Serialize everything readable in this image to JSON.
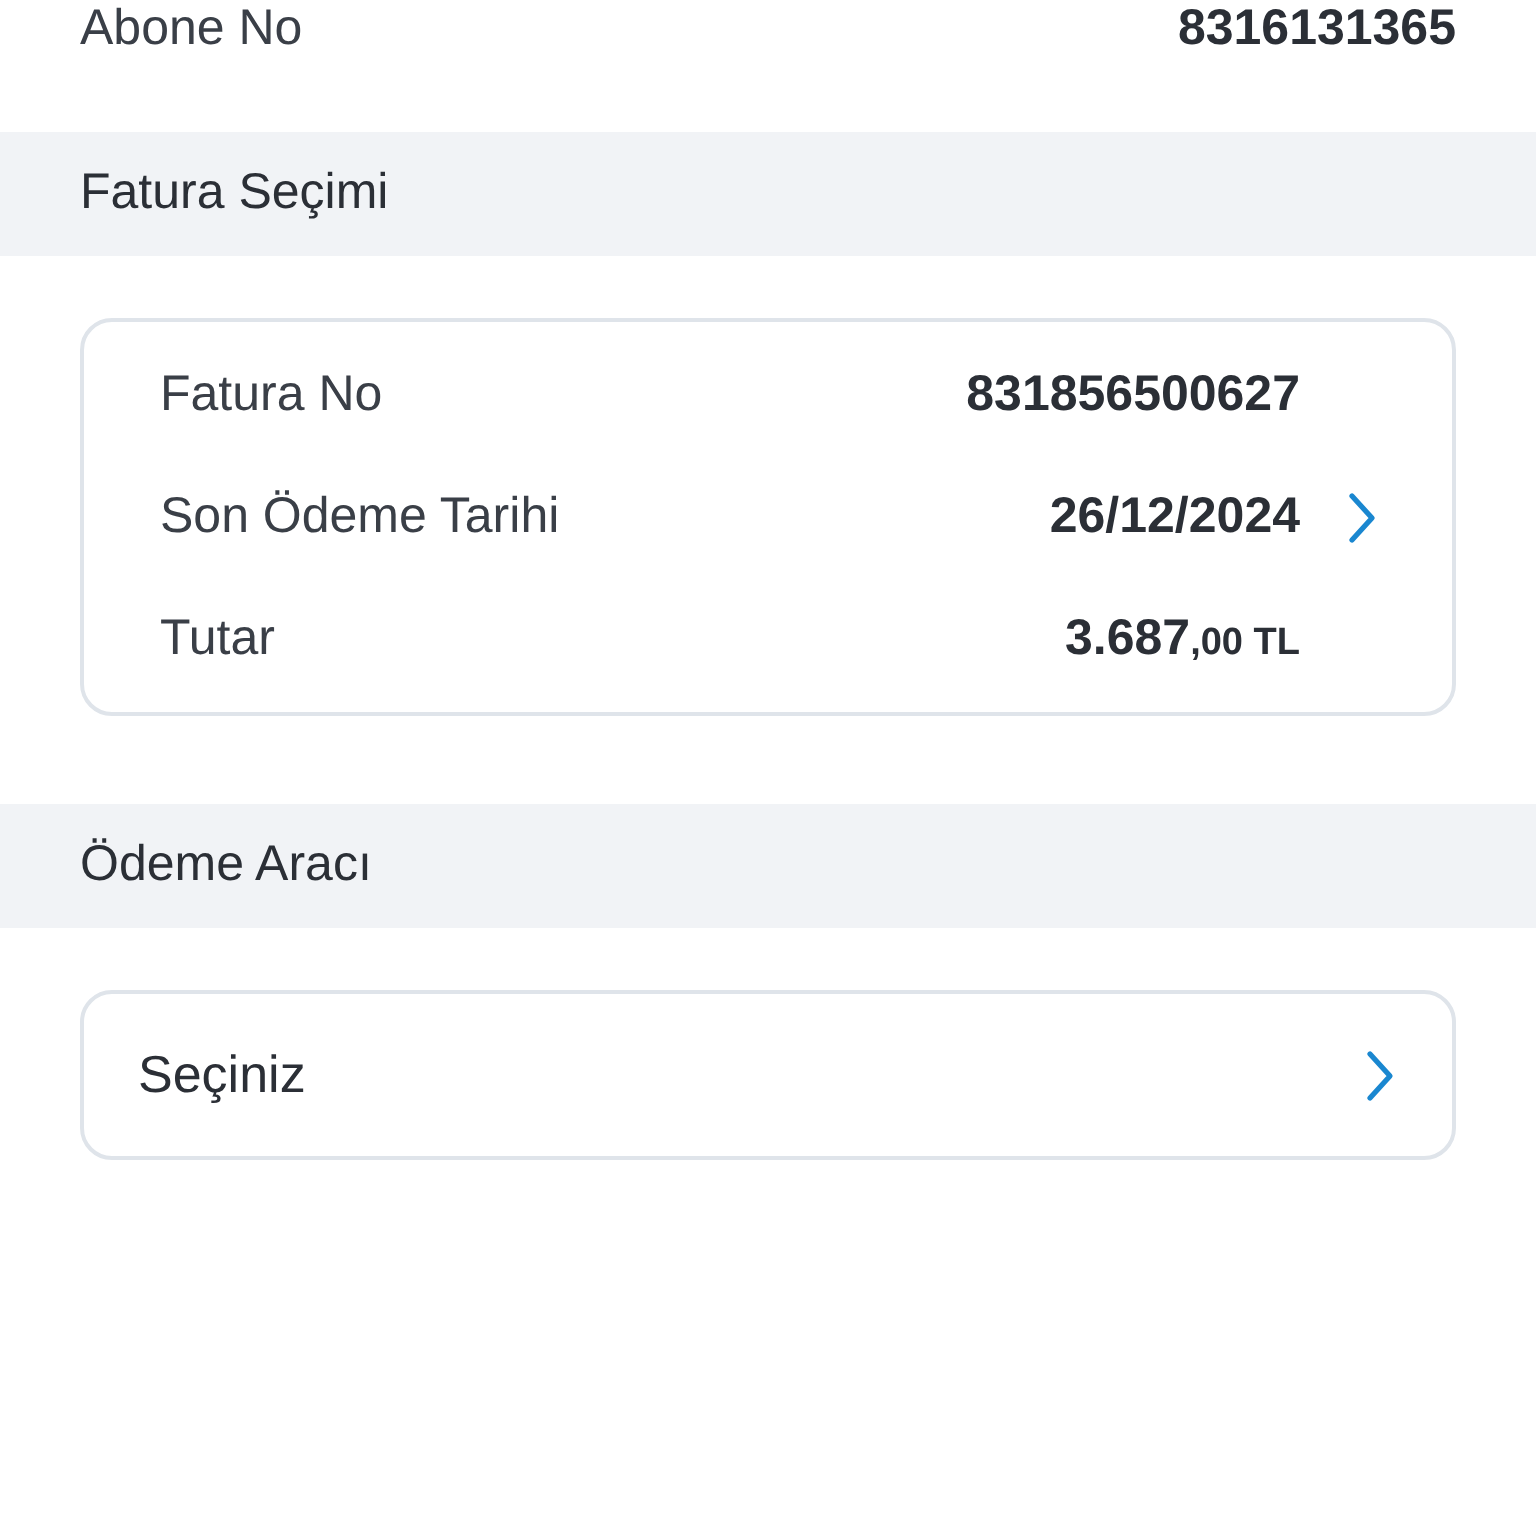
{
  "subscriber": {
    "label": "Abone No",
    "value": "8316131365"
  },
  "invoice_section": {
    "title": "Fatura Seçimi",
    "rows": [
      {
        "label": "Fatura No",
        "value": "831856500627"
      },
      {
        "label": "Son Ödeme Tarihi",
        "value": "26/12/2024"
      },
      {
        "label": "Tutar",
        "value": "3.687",
        "value_fraction": ",00",
        "currency": "TL"
      }
    ]
  },
  "payment_section": {
    "title": "Ödeme Aracı",
    "selector": {
      "placeholder": "Seçiniz"
    }
  }
}
